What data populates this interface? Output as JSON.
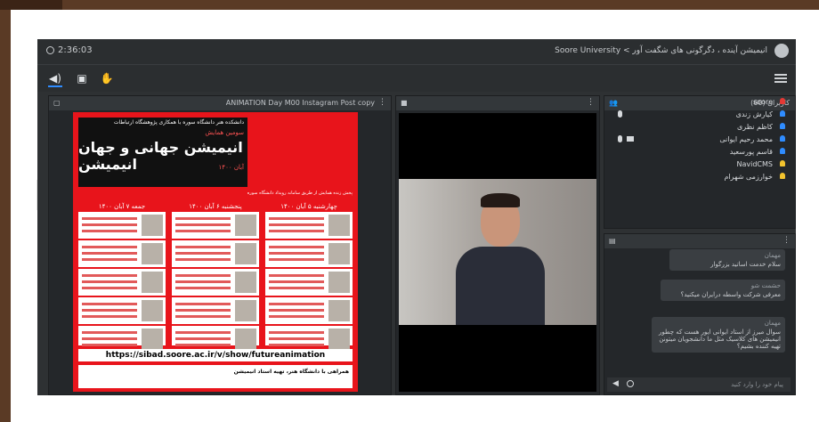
{
  "session": {
    "elapsed": "2:36:03"
  },
  "breadcrumb": "Soore University < انیمیشن آینده ، دگرگونی های شگفت آور",
  "toolbar": {
    "icons": [
      "speaker-icon",
      "share-screen-icon",
      "raise-hand-icon",
      "menu-icon"
    ]
  },
  "presentation": {
    "title": "ANIMATION Day M00 Instagram Post copy",
    "poster": {
      "header_small": "دانشکده هنر دانشگاه سوره با همکاری پژوهشگاه ارتباطات",
      "header_sub": "سومین همایش",
      "main_title": "انیمیشن جهانی و جهان انیمیشن",
      "date_line": "آبان ۱۴۰۰",
      "note": "پخش زنده همایش از طریق سامانه رویداد دانشگاه سوره",
      "days": [
        "جمعه ۷ آبان ۱۴۰۰",
        "پنجشنبه ۶ آبان ۱۴۰۰",
        "چهارشنبه ۵ آبان ۱۴۰۰"
      ],
      "url": "https://sibad.soore.ac.ir/v/show/futureanimation",
      "footer": "همراهی با دانشگاه هنر، تهیه استاد انیمیشن"
    }
  },
  "users": {
    "header": "کاربران (60)",
    "list": [
      {
        "name": "soore",
        "color": "#e53935",
        "mic": false,
        "cam": false
      },
      {
        "name": "کیارش زندی",
        "color": "#2f8cff",
        "mic": true,
        "cam": false
      },
      {
        "name": "کاظم نظری",
        "color": "#2f8cff",
        "mic": false,
        "cam": false
      },
      {
        "name": "محمد رحیم ایوانی",
        "color": "#2f8cff",
        "mic": true,
        "cam": true
      },
      {
        "name": "قاسم پورسعید",
        "color": "#2f8cff",
        "mic": false,
        "cam": false
      },
      {
        "name": "NavidCMS",
        "color": "#f2c32e",
        "mic": false,
        "cam": false
      },
      {
        "name": "خوارزمی شهرام",
        "color": "#f2c32e",
        "mic": false,
        "cam": false
      }
    ]
  },
  "chat": {
    "messages": [
      {
        "who": "مهمان",
        "text": "سلام خدمت اساتید بزرگوار"
      },
      {
        "who": "حشمت شو",
        "text": "معرفی شرکت واسطه درایران میکنید؟"
      },
      {
        "who": "مهمان",
        "text": "سوال میرز از استاد ایوانی ایور هست که چطور انیمیشن های کلاسیک مثل ما دانشجویان میتونن تهیه کننده بشیم؟"
      }
    ],
    "input_placeholder": "پیام خود را وارد کنید"
  }
}
